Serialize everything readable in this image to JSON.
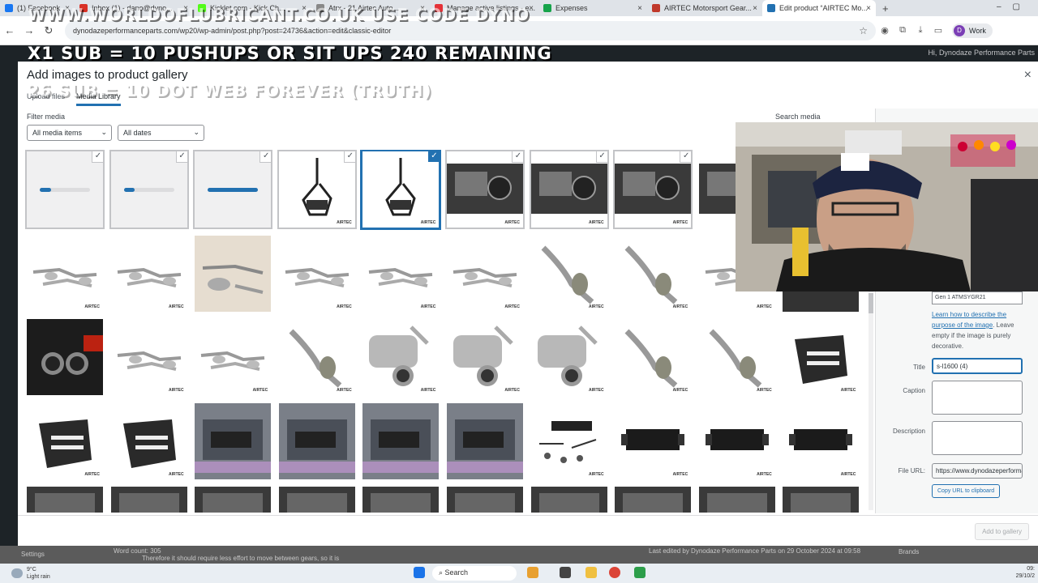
{
  "browser": {
    "tabs": [
      {
        "label": "(1) Facebook",
        "color": "#1877f2"
      },
      {
        "label": "Inbox (1) - dano@dyno...",
        "color": "#d93025"
      },
      {
        "label": "Kicklet.com - Kick Ch...",
        "color": "#53fc18"
      },
      {
        "label": "Atrx - 21 Airtec Auto...",
        "color": "#888888"
      },
      {
        "label": "Manage active listings - e...",
        "color": "#e53238"
      },
      {
        "label": "Expenses",
        "color": "#16a34a"
      },
      {
        "label": "AIRTEC Motorsport Gear...",
        "color": "#c0392b"
      },
      {
        "label": "Edit product “AIRTEC Mo...",
        "color": "#2271b1",
        "active": true
      }
    ],
    "new_tab": "+",
    "url": "dynodazeperformanceparts.com/wp20/wp-admin/post.php?post=24736&action=edit&classic-editor",
    "profile": {
      "initial": "D",
      "label": "Work"
    }
  },
  "overlay": {
    "line1": "WWW.WORLDOFLUBRICANT.CO.UK USE CODE DYNO",
    "line2": "X1 SUB = 10 PUSHUPS OR SIT UPS 240 REMAINING",
    "line3": "26 SUB = 10 DOT WEB FOREVER (TRUTH)"
  },
  "wp": {
    "greeting": "Hi, Dynodaze Performance Parts"
  },
  "modal": {
    "title": "Add images to product gallery",
    "close": "×",
    "tabs": [
      "Upload files",
      "Media Library"
    ],
    "filter_label": "Filter media",
    "type_filter": "All media items",
    "date_filter": "All dates",
    "search_label": "Search media",
    "add_button": "Add to gallery"
  },
  "media": {
    "tiles": [
      {
        "kind": "progress",
        "progress": 0.22,
        "selected": true
      },
      {
        "kind": "progress",
        "progress": 0.22,
        "selected": true
      },
      {
        "kind": "progress",
        "progress": 1.0,
        "selected": true
      },
      {
        "kind": "mount",
        "selected": true
      },
      {
        "kind": "mount",
        "selected": true,
        "focus": true
      },
      {
        "kind": "interior",
        "selected": true
      },
      {
        "kind": "interior",
        "selected": true
      },
      {
        "kind": "interior",
        "selected": true
      },
      {
        "kind": "interior",
        "selected": false
      },
      {
        "kind": "blank",
        "selected": false
      },
      {
        "kind": "exhaust",
        "selected": false
      },
      {
        "kind": "exhaust",
        "selected": false
      },
      {
        "kind": "exhaust-beige",
        "selected": false
      },
      {
        "kind": "exhaust",
        "selected": false
      },
      {
        "kind": "exhaust",
        "selected": false
      },
      {
        "kind": "exhaust",
        "selected": false
      },
      {
        "kind": "pipe",
        "selected": false
      },
      {
        "kind": "pipe",
        "selected": false
      },
      {
        "kind": "exhaust",
        "selected": false
      },
      {
        "kind": "car",
        "selected": false
      },
      {
        "kind": "tips",
        "selected": false
      },
      {
        "kind": "exhaust",
        "selected": false
      },
      {
        "kind": "exhaust",
        "selected": false
      },
      {
        "kind": "pipe",
        "selected": false
      },
      {
        "kind": "muffler",
        "selected": false
      },
      {
        "kind": "muffler",
        "selected": false
      },
      {
        "kind": "muffler",
        "selected": false
      },
      {
        "kind": "pipe",
        "selected": false
      },
      {
        "kind": "pipe",
        "selected": false
      },
      {
        "kind": "plate",
        "selected": false
      },
      {
        "kind": "plate",
        "selected": false
      },
      {
        "kind": "plate",
        "selected": false
      },
      {
        "kind": "under",
        "selected": false
      },
      {
        "kind": "under",
        "selected": false
      },
      {
        "kind": "under",
        "selected": false
      },
      {
        "kind": "under",
        "selected": false
      },
      {
        "kind": "kit",
        "selected": false
      },
      {
        "kind": "intercooler",
        "selected": false
      },
      {
        "kind": "intercooler",
        "selected": false
      },
      {
        "kind": "intercooler",
        "selected": false
      },
      {
        "kind": "dark",
        "selected": false
      },
      {
        "kind": "dark",
        "selected": false
      },
      {
        "kind": "dark",
        "selected": false
      },
      {
        "kind": "dark",
        "selected": false
      },
      {
        "kind": "dark",
        "selected": false
      },
      {
        "kind": "dark",
        "selected": false
      },
      {
        "kind": "dark",
        "selected": false
      },
      {
        "kind": "dark",
        "selected": false
      },
      {
        "kind": "dark",
        "selected": false
      },
      {
        "kind": "dark",
        "selected": false
      }
    ],
    "brand": "AIRTEC"
  },
  "details": {
    "alt_text": "Gen 1 ATMSYGR21",
    "learn_link": "Learn how to describe the purpose of the image",
    "learn_rest": ". Leave empty if the image is purely decorative.",
    "title_label": "Title",
    "title_value": "s-l1600 (4)",
    "caption_label": "Caption",
    "description_label": "Description",
    "file_url_label": "File URL:",
    "file_url": "https://www.dynodazeperformanceparts.com",
    "copy_button": "Copy URL to clipboard"
  },
  "footer": {
    "word_count": "Word count: 305",
    "last_edited": "Last edited by Dynodaze Performance Parts on 29 October 2024 at 09:58",
    "brands": "Brands",
    "settings": "Settings",
    "note": "Therefore it should require less effort to move between gears, so it is"
  },
  "taskbar": {
    "temp": "9°C",
    "weather": "Light rain",
    "search": "Search",
    "time": "09:",
    "date": "29/10/2"
  }
}
